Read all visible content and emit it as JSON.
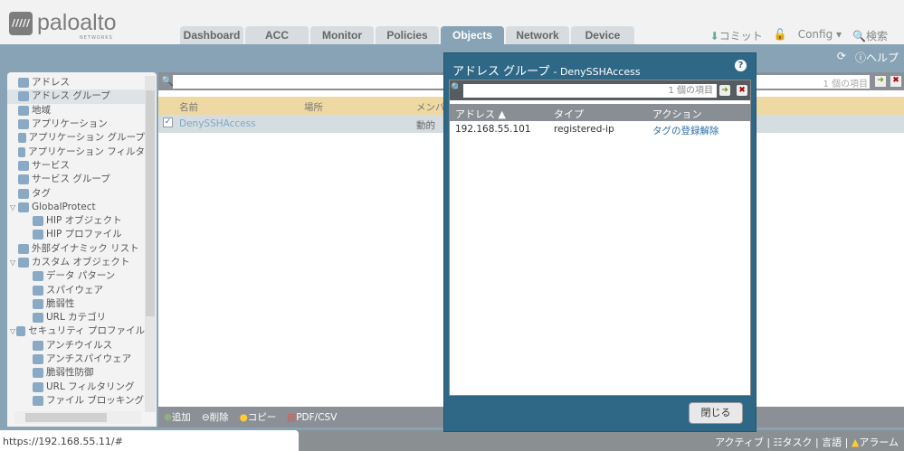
{
  "header": {
    "logo_mark": "/////",
    "logo": "paloalto",
    "logo_sub": "NETWORKS",
    "tabs": [
      "Dashboard",
      "ACC",
      "Monitor",
      "Policies",
      "Objects",
      "Network",
      "Device"
    ],
    "active_tab": "Objects",
    "commit": "コミット",
    "config": "Config ▾",
    "search": "検索",
    "help": "ヘルプ"
  },
  "sidebar": {
    "items": [
      {
        "label": "アドレス",
        "level": 0
      },
      {
        "label": "アドレス グループ",
        "level": 0,
        "selected": true
      },
      {
        "label": "地域",
        "level": 0
      },
      {
        "label": "アプリケーション",
        "level": 0
      },
      {
        "label": "アプリケーション グループ",
        "level": 0
      },
      {
        "label": "アプリケーション フィルタ",
        "level": 0
      },
      {
        "label": "サービス",
        "level": 0
      },
      {
        "label": "サービス グループ",
        "level": 0
      },
      {
        "label": "タグ",
        "level": 0
      },
      {
        "label": "GlobalProtect",
        "level": 0,
        "expanded": true
      },
      {
        "label": "HIP オブジェクト",
        "level": 1
      },
      {
        "label": "HIP プロファイル",
        "level": 1
      },
      {
        "label": "外部ダイナミック リスト",
        "level": 0
      },
      {
        "label": "カスタム オブジェクト",
        "level": 0,
        "expanded": true
      },
      {
        "label": "データ パターン",
        "level": 1
      },
      {
        "label": "スパイウェア",
        "level": 1
      },
      {
        "label": "脆弱性",
        "level": 1
      },
      {
        "label": "URL カテゴリ",
        "level": 1
      },
      {
        "label": "セキュリティ プロファイル",
        "level": 0,
        "expanded": true
      },
      {
        "label": "アンチウイルス",
        "level": 1
      },
      {
        "label": "アンチスパイウェア",
        "level": 1
      },
      {
        "label": "脆弱性防御",
        "level": 1
      },
      {
        "label": "URL フィルタリング",
        "level": 1
      },
      {
        "label": "ファイル ブロッキング",
        "level": 1
      }
    ]
  },
  "main": {
    "count": "1 個の項目",
    "columns": [
      "名前",
      "場所",
      "メンバ"
    ],
    "rows": [
      {
        "name": "DenySSHAccess",
        "location": "",
        "members": "動的"
      }
    ]
  },
  "toolbar": {
    "add": "追加",
    "delete": "削除",
    "copy": "コピー",
    "pdf": "PDF/CSV"
  },
  "status": {
    "url": "https://192.168.55.11/#",
    "active": "アクティブ",
    "tasks": "タスク",
    "language": "言語",
    "alarms": "アラーム"
  },
  "modal": {
    "title": "アドレス グループ",
    "subtitle": "- DenySSHAccess",
    "count": "1 個の項目",
    "columns": [
      "アドレス ▲",
      "タイプ",
      "アクション"
    ],
    "rows": [
      {
        "address": "192.168.55.101",
        "type": "registered-ip",
        "action": "タグの登録解除"
      }
    ],
    "close": "閉じる"
  }
}
